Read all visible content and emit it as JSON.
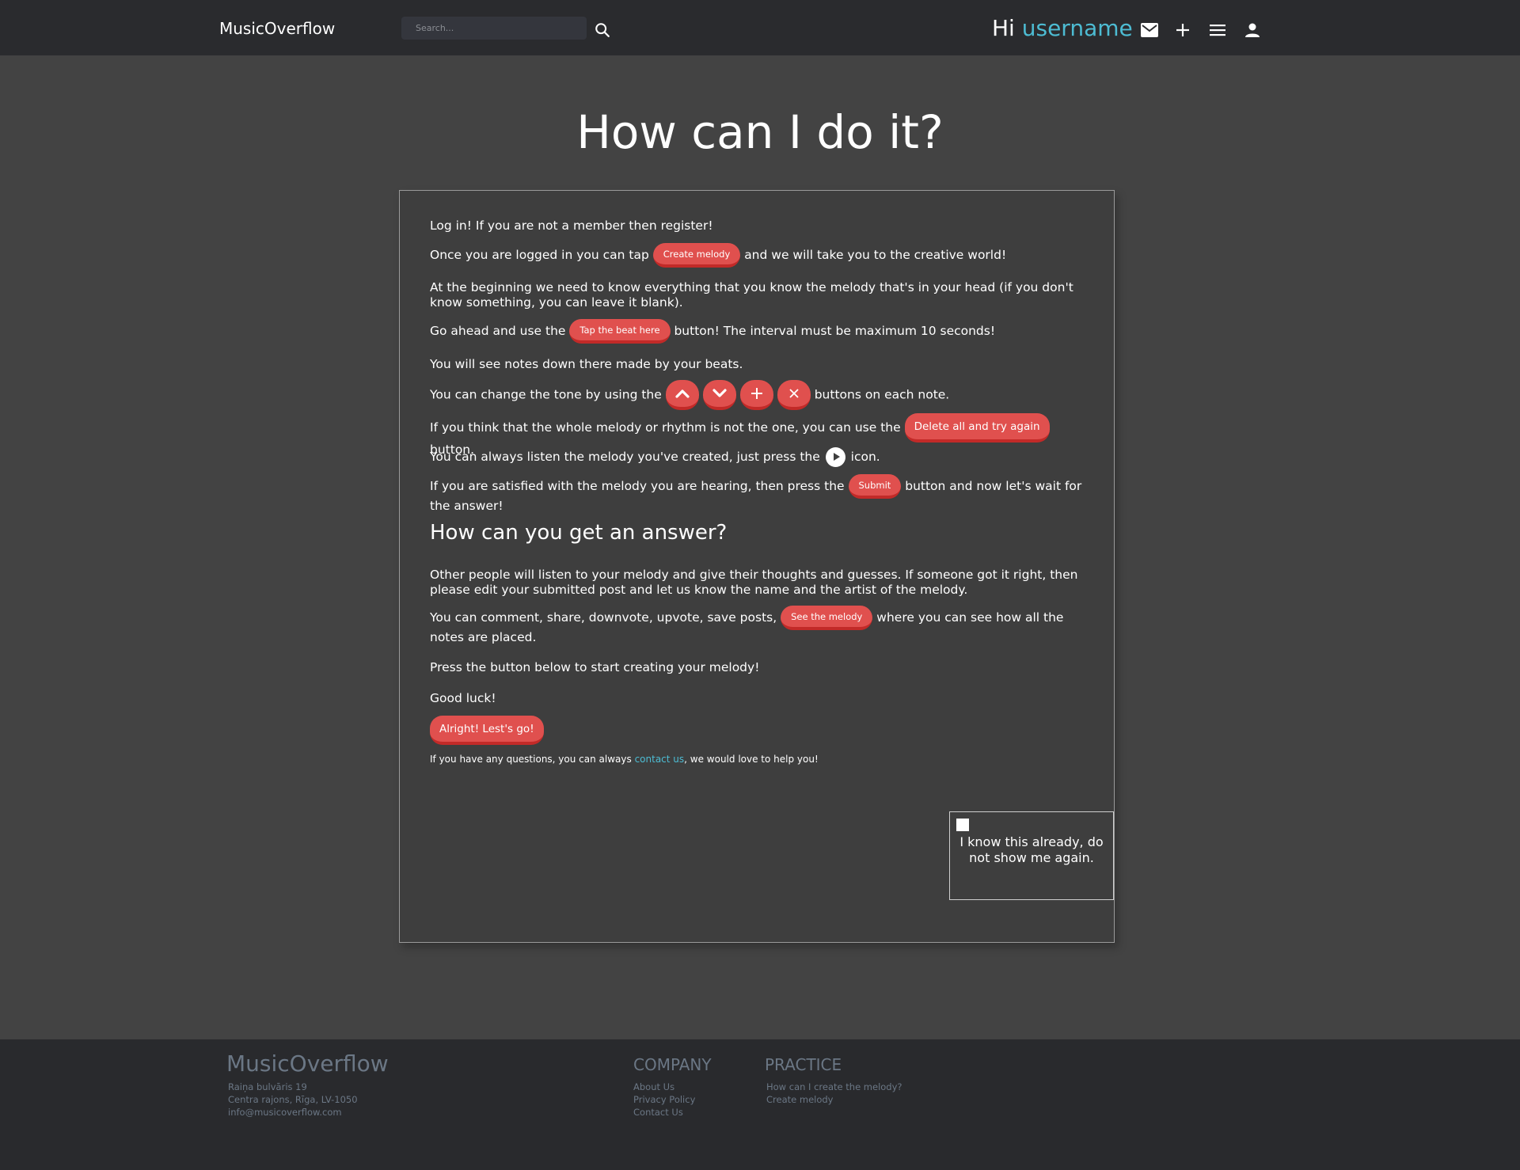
{
  "header": {
    "logo": "MusicOverflow",
    "search_placeholder": "Search...",
    "greeting": "Hi",
    "username": "username",
    "icons": [
      "search-icon",
      "mail-icon",
      "plus-icon",
      "menu-icon",
      "user-icon"
    ]
  },
  "main": {
    "title": "How can I do it?",
    "p1": "Log in! If you are not a member then register!",
    "p2_before": "Once you are logged in you can tap",
    "p2_button": "Create melody",
    "p2_after": "and we will take you to the creative world!",
    "p3": "At the beginning we need to know everything that you know the melody that's in your head (if you don't know something, you can leave it blank).",
    "p4_before": "Go ahead and use the",
    "p4_button": "Tap the beat here",
    "p4_after": "button! The interval must be maximum 10 seconds!",
    "p5": "You will see notes down there made by your beats.",
    "p6_before": "You can change the tone by using the",
    "p6_after": "buttons on each note.",
    "p7_before": "If you think that the whole melody or rhythm is not the one, you can use the",
    "p7_button": "Delete all and try again",
    "p7_after": "button.",
    "p8_before": "You can always listen the melody you've created, just press the",
    "p8_after": "icon.",
    "p9_before": "If you are satisfied with the melody you are hearing, then press the",
    "p9_button": "Submit",
    "p9_after": "button and now let's wait for the answer!",
    "subheading": "How can you get an answer?",
    "p10": "Other people will listen to your melody and give their thoughts and guesses. If someone got it right, then please edit your submitted post and let us know the name and the artist of the melody.",
    "p11_before": "You can comment, share, downvote, upvote, save posts,",
    "p11_button": "See the melody",
    "p11_after": "where you can see how all the notes are placed.",
    "p12": "Press the button below to start creating your melody!",
    "p13": "Good luck!",
    "cta_button": "Alright! Lest's go!",
    "note_before": "If you have any questions, you can always",
    "note_link": "contact us",
    "note_after": ", we would love to help you!",
    "checkbox_label": "I know this already, do not show me again."
  },
  "footer": {
    "logo": "MusicOverflow",
    "address_lines": [
      "Raiņa bulvāris 19",
      "Centra rajons, Rīga, LV-1050",
      "info@musicoverflow.com"
    ],
    "company_title": "COMPANY",
    "company_links": [
      "About Us",
      "Privacy Policy",
      "Contact Us"
    ],
    "practice_title": "PRACTICE",
    "practice_links": [
      "How can I create the melody?",
      "Create melody"
    ]
  },
  "colors": {
    "accent_red": "#e0504e",
    "link_blue": "#4dbcd3",
    "header_bg": "#2a2b2e",
    "page_bg": "#434343"
  }
}
